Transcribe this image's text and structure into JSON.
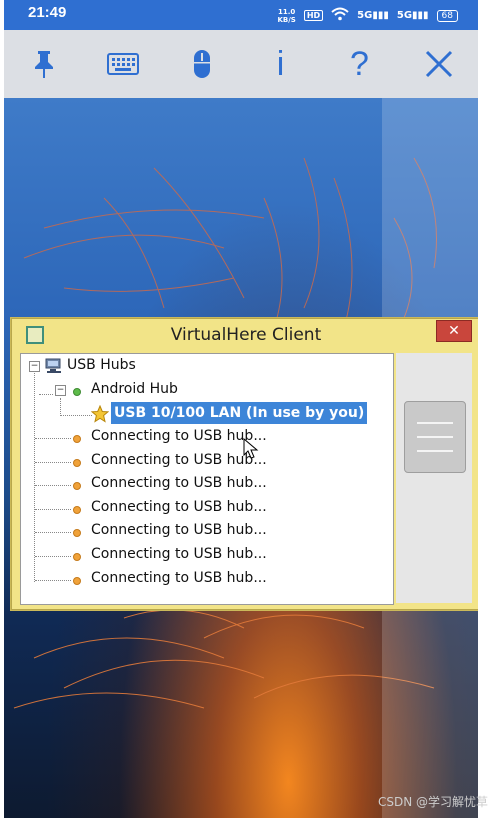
{
  "status_bar": {
    "time": "21:49",
    "net_speed": "11.0",
    "net_unit": "KB/S",
    "hd": "HD",
    "signal1": "5G",
    "signal2": "5G",
    "battery": "68"
  },
  "toolbar": {
    "items": [
      {
        "name": "pin",
        "icon": "pin-icon"
      },
      {
        "name": "keyboard",
        "icon": "keyboard-icon"
      },
      {
        "name": "mouse",
        "icon": "mouse-icon"
      },
      {
        "name": "info",
        "icon": "info-icon",
        "text": "i"
      },
      {
        "name": "help",
        "icon": "help-icon",
        "text": "?"
      },
      {
        "name": "close",
        "icon": "close-icon"
      }
    ],
    "info_label": "i",
    "help_label": "?"
  },
  "dialog": {
    "title": "VirtualHere Client",
    "close_glyph": "✕",
    "tree": {
      "root": "USB Hubs",
      "hub": "Android Hub",
      "device": "USB 10/100 LAN (In use by you)",
      "connecting": [
        "Connecting to USB hub...",
        "Connecting to USB hub...",
        "Connecting to USB hub...",
        "Connecting to USB hub...",
        "Connecting to USB hub...",
        "Connecting to USB hub...",
        "Connecting to USB hub..."
      ]
    }
  },
  "watermark": "CSDN @学习解忧草",
  "colors": {
    "accent": "#2f6fd1",
    "dialog_bg": "#f2e488",
    "selection": "#3d85d8",
    "close_red": "#c9463c"
  }
}
